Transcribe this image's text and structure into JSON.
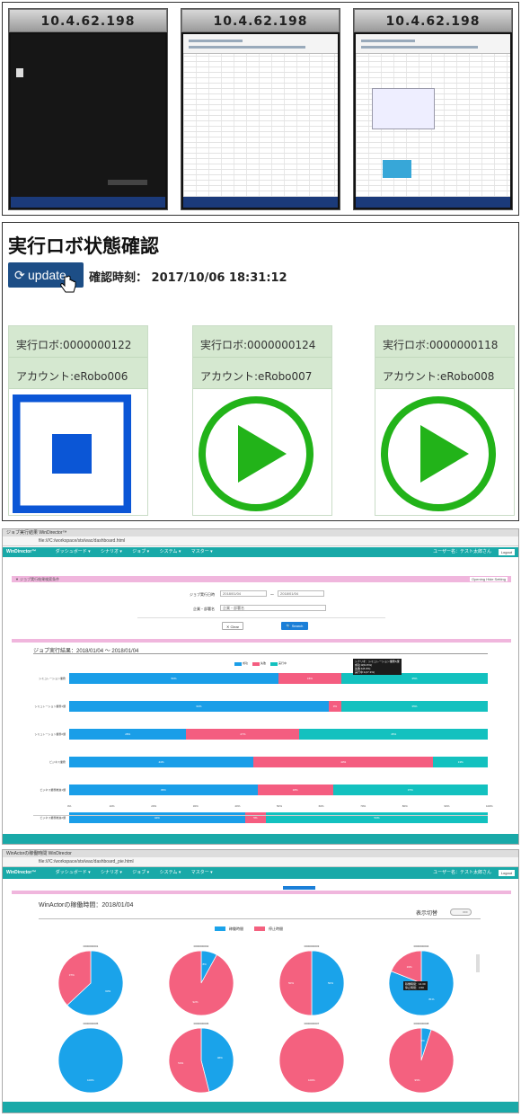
{
  "panel1": {
    "ips": [
      "10.4.62.198",
      "10.4.62.198",
      "10.4.62.198"
    ]
  },
  "panel2": {
    "title": "実行ロボ状態確認",
    "update_label": "update",
    "confirm_label": "確認時刻：",
    "confirm_time": "2017/10/06 18:31:12",
    "robots": [
      {
        "robo": "実行ロボ:0000000122",
        "account": "アカウント:eRobo006",
        "state": "stop"
      },
      {
        "robo": "実行ロボ:0000000124",
        "account": "アカウント:eRobo007",
        "state": "play"
      },
      {
        "robo": "実行ロボ:0000000118",
        "account": "アカウント:eRobo008",
        "state": "play"
      }
    ],
    "colors": {
      "button": "#1d4e86",
      "card_header": "#d5e8d0",
      "stop": "#0b56d6",
      "play": "#22b319"
    }
  },
  "panel3": {
    "tab": "ジョブ実行結果 WinDirector™",
    "url": "file:///C:/workspace/sts/wac/dashboard.html",
    "brand": "WinDirector™",
    "menu": [
      "ダッシュボード ▾",
      "シナリオ ▾",
      "ジョブ ▾",
      "システム ▾",
      "マスター ▾"
    ],
    "user": "ユーザー名：テスト太郎さん",
    "logout": "Logout",
    "filter_title": "▼ ジョブ実行結果検索条件",
    "filter_right": "Opening Hide Setting",
    "date_label": "ジョブ実行日時",
    "date_from": "2018/01/04",
    "date_sep": "〜",
    "date_to": "2018/01/04",
    "name_label": "企業・部署名",
    "name_placeholder": "企業・部署名",
    "clear": "✕ Clear",
    "search": "🔍 Search",
    "result_title": "ジョブ実行結果：2018/01/04 〜 2018/01/04",
    "tooltip": [
      "シナリオ：シミュレーション業務1課",
      "成功:3(64.5%)",
      "失敗:1(8.2%)",
      "実行中:1(27.3%)"
    ]
  },
  "panel4": {
    "tab": "WinActorの稼働時間 WinDirector",
    "url": "file:///C:/workspace/sts/wac/dashboard_pie.html",
    "brand": "WinDirector™",
    "menu": [
      "ダッシュボード ▾",
      "シナリオ ▾",
      "ジョブ ▾",
      "システム ▾",
      "マスター ▾"
    ],
    "user": "ユーザー名：テスト太郎さん",
    "logout": "Logout",
    "title": "WinActorの稼働時間：2018/01/04",
    "toggle_label": "表示切替",
    "toggle_state": "OFF",
    "tooltip": [
      "稼働時間：14.30",
      "停止時間：4.50"
    ]
  },
  "chart_data": [
    {
      "type": "bar",
      "orientation": "horizontal",
      "stacked": true,
      "categories": [
        "シミュレーション業務",
        "シミュレーション業務1課",
        "シミュレーション業務2課",
        "ビジネス業務",
        "ビジネス業務推進1課",
        "ビジネス業務推進2課"
      ],
      "series": [
        {
          "name": "成功",
          "color": "#1a9ee8",
          "values": [
            50,
            62,
            28,
            44,
            45,
            42
          ]
        },
        {
          "name": "失敗",
          "color": "#f45d80",
          "values": [
            15,
            3,
            27,
            43,
            18,
            5
          ]
        },
        {
          "name": "実行中",
          "color": "#13c1bf",
          "values": [
            35,
            35,
            45,
            13,
            37,
            53
          ]
        }
      ],
      "xlim": [
        0,
        100
      ],
      "xticks": [
        "0%",
        "10%",
        "20%",
        "30%",
        "40%",
        "50%",
        "60%",
        "70%",
        "80%",
        "90%",
        "100%"
      ],
      "legend": "top"
    },
    {
      "type": "pie",
      "series_names": [
        "稼働時間",
        "停止時間"
      ],
      "colors": [
        "#1aa3ea",
        "#f4617f"
      ],
      "pies": [
        {
          "label": "0000000001",
          "values": [
            63,
            37
          ]
        },
        {
          "label": "0000000002",
          "values": [
            8,
            92
          ]
        },
        {
          "label": "0000000003",
          "values": [
            50,
            50
          ]
        },
        {
          "label": "0000000004",
          "values": [
            81,
            19
          ]
        },
        {
          "label": "0000000005",
          "values": [
            100,
            0
          ]
        },
        {
          "label": "0000000006",
          "values": [
            46,
            54
          ]
        },
        {
          "label": "0000000007",
          "values": [
            0,
            100
          ]
        },
        {
          "label": "0000000008",
          "values": [
            5,
            95
          ]
        }
      ]
    }
  ]
}
